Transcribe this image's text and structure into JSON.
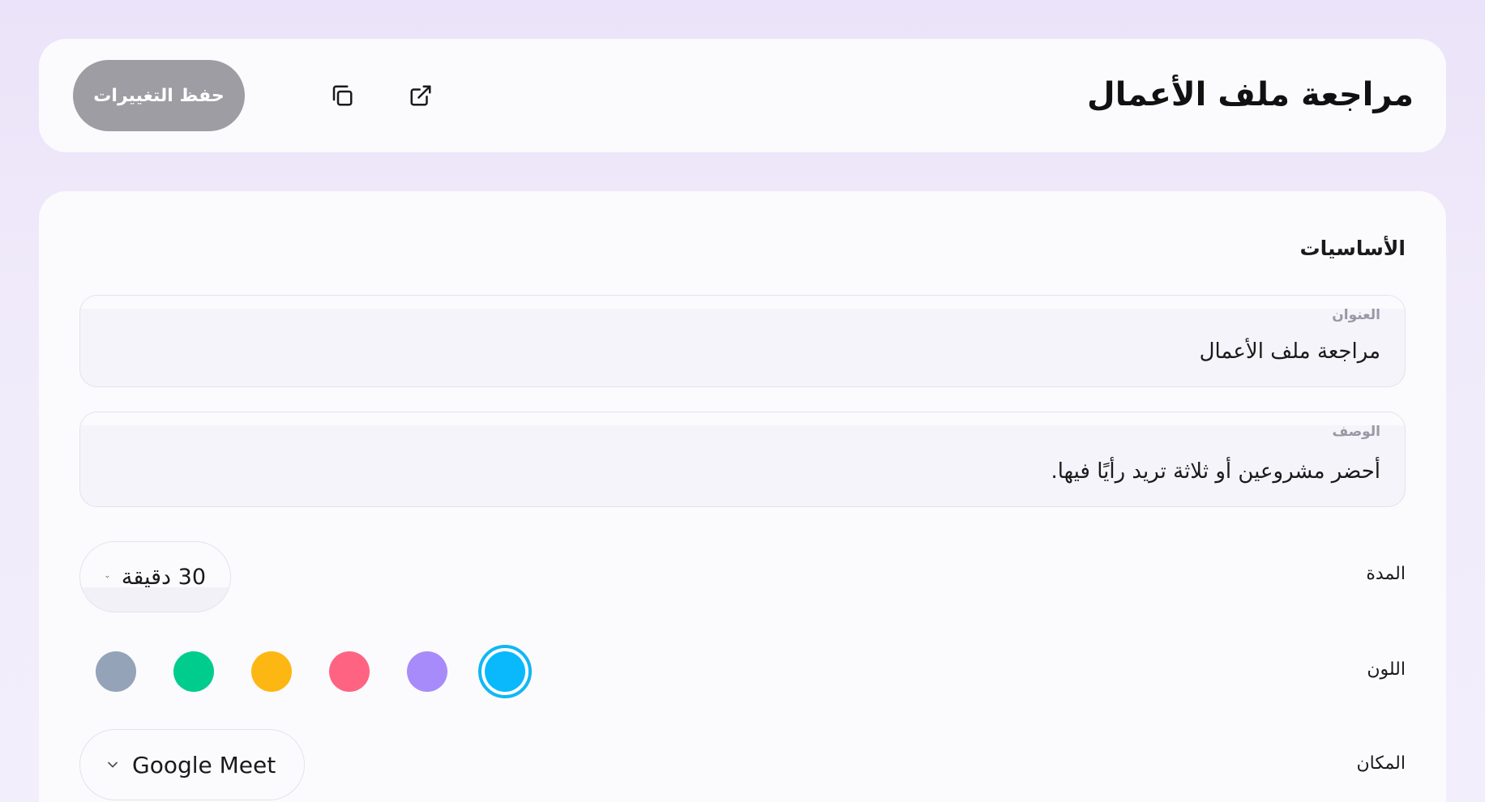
{
  "header": {
    "title": "مراجعة ملف الأعمال",
    "save_label": "حفظ التغييرات",
    "icons": [
      "copy-icon",
      "external-link-icon"
    ]
  },
  "basics": {
    "section_title": "الأساسيات",
    "title_field": {
      "label": "العنوان",
      "value": "مراجعة ملف الأعمال"
    },
    "description_field": {
      "label": "الوصف",
      "value": "أحضر مشروعين أو ثلاثة تريد رأيًا فيها."
    },
    "duration": {
      "label": "المدة",
      "value": "30 دقيقة"
    },
    "color": {
      "label": "اللون",
      "options": [
        "#94a3b8",
        "#00cc8d",
        "#fdb713",
        "#fe6482",
        "#a78bfa",
        "#0ab9fc"
      ],
      "selected": "#0ab9fc"
    },
    "location": {
      "label": "المكان",
      "value": "Google Meet"
    }
  }
}
